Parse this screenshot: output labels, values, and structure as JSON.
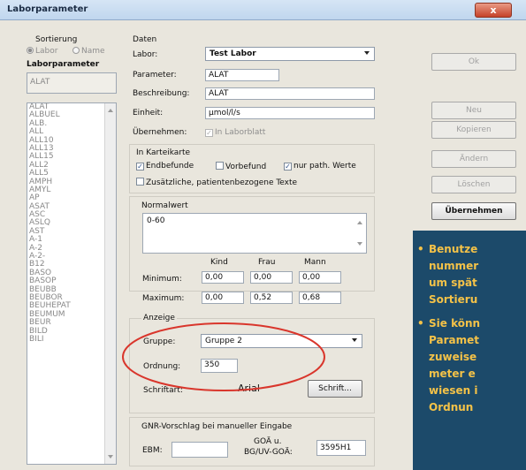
{
  "window": {
    "title": "Laborparameter",
    "close_glyph": "x"
  },
  "left": {
    "sorting_title": "Sortierung",
    "sort_options": [
      {
        "label": "Labor",
        "selected": true
      },
      {
        "label": "Name",
        "selected": false
      }
    ],
    "params_title": "Laborparameter",
    "search_value": "ALAT",
    "list_items": [
      "ALAT",
      "ALBUEL",
      "ALB.",
      "ALL",
      "ALL10",
      "ALL13",
      "ALL15",
      "ALL2",
      "ALL5",
      "AMPH",
      "AMYL",
      "AP",
      "ASAT",
      "ASC",
      "ASLQ",
      "AST",
      "A-1",
      "A-2",
      "A-2-",
      "B12",
      "BASO",
      "BASOP",
      "BEUBB",
      "BEUBOR",
      "BEUHEPAT",
      "BEUMUM",
      "BEUR",
      "BILD",
      "BILI"
    ]
  },
  "daten": {
    "title": "Daten",
    "labor_label": "Labor:",
    "labor_value": "Test Labor",
    "parameter_label": "Parameter:",
    "parameter_value": "ALAT",
    "beschreibung_label": "Beschreibung:",
    "beschreibung_value": "ALAT",
    "einheit_label": "Einheit:",
    "einheit_value": "µmol/l/s",
    "uebernehmen_label": "Übernehmen:",
    "in_laborblatt": "In Laborblatt"
  },
  "karteikarte": {
    "title": "In Karteikarte",
    "endbefunde": {
      "label": "Endbefunde",
      "checked": true
    },
    "vorbefund": {
      "label": "Vorbefund",
      "checked": false
    },
    "nur_path": {
      "label": "nur path. Werte",
      "checked": true
    },
    "zusaetzliche": {
      "label": "Zusätzliche, patientenbezogene Texte",
      "checked": false
    }
  },
  "normalwert": {
    "title": "Normalwert",
    "value": "0-60",
    "col_kind": "Kind",
    "col_frau": "Frau",
    "col_mann": "Mann",
    "minimum_label": "Minimum:",
    "maximum_label": "Maximum:",
    "min": {
      "kind": "0,00",
      "frau": "0,00",
      "mann": "0,00"
    },
    "max": {
      "kind": "0,00",
      "frau": "0,52",
      "mann": "0,68"
    }
  },
  "anzeige": {
    "title": "Anzeige",
    "gruppe_label": "Gruppe:",
    "gruppe_value": "Gruppe 2",
    "ordnung_label": "Ordnung:",
    "ordnung_value": "350",
    "schriftart_label": "Schriftart:",
    "schriftart_value": "Arial",
    "schrift_button": "Schrift..."
  },
  "gnr": {
    "title": "GNR-Vorschlag bei manueller Eingabe",
    "ebm_label": "EBM:",
    "goa_label_1": "GOÄ u.",
    "goa_label_2": "BG/UV-GOÄ:",
    "goa_value": "3595H1"
  },
  "buttons": {
    "ok": "Ok",
    "neu": "Neu",
    "kopieren": "Kopieren",
    "aendern": "Ändern",
    "loeschen": "Löschen",
    "uebernehmen": "Übernehmen"
  },
  "overlay": {
    "bullets": [
      [
        "Benutze",
        "nummer",
        "um spät",
        "Sortieru"
      ],
      [
        "Sie könn",
        "Paramet",
        "zuweise",
        "meter e",
        "wiesen i",
        "Ordnun"
      ]
    ]
  },
  "colors": {
    "highlight": "#d9362c",
    "overlay_bg": "#1c4a6a",
    "overlay_text": "#f4c248"
  }
}
